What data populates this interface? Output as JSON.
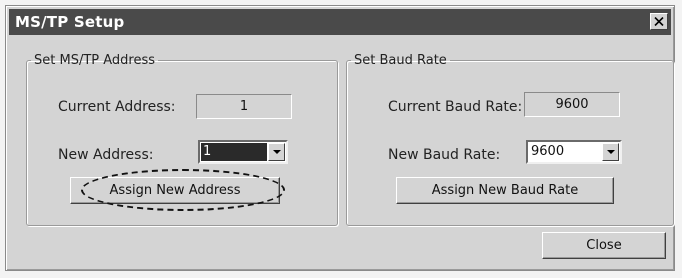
{
  "window": {
    "title": "MS/TP Setup",
    "close_icon": "close-x-icon"
  },
  "address_group": {
    "legend": "Set MS/TP Address",
    "current_label": "Current Address:",
    "current_value": "1",
    "new_label": "New Address:",
    "new_value": "1",
    "assign_button": "Assign New Address"
  },
  "baud_group": {
    "legend": "Set Baud Rate",
    "current_label": "Current Baud Rate:",
    "current_value": "9600",
    "new_label": "New Baud Rate:",
    "new_value": "9600",
    "assign_button": "Assign New Baud Rate"
  },
  "footer": {
    "close_button": "Close"
  },
  "colors": {
    "titlebar": "#4a4a4a",
    "face": "#d4d4d4"
  }
}
